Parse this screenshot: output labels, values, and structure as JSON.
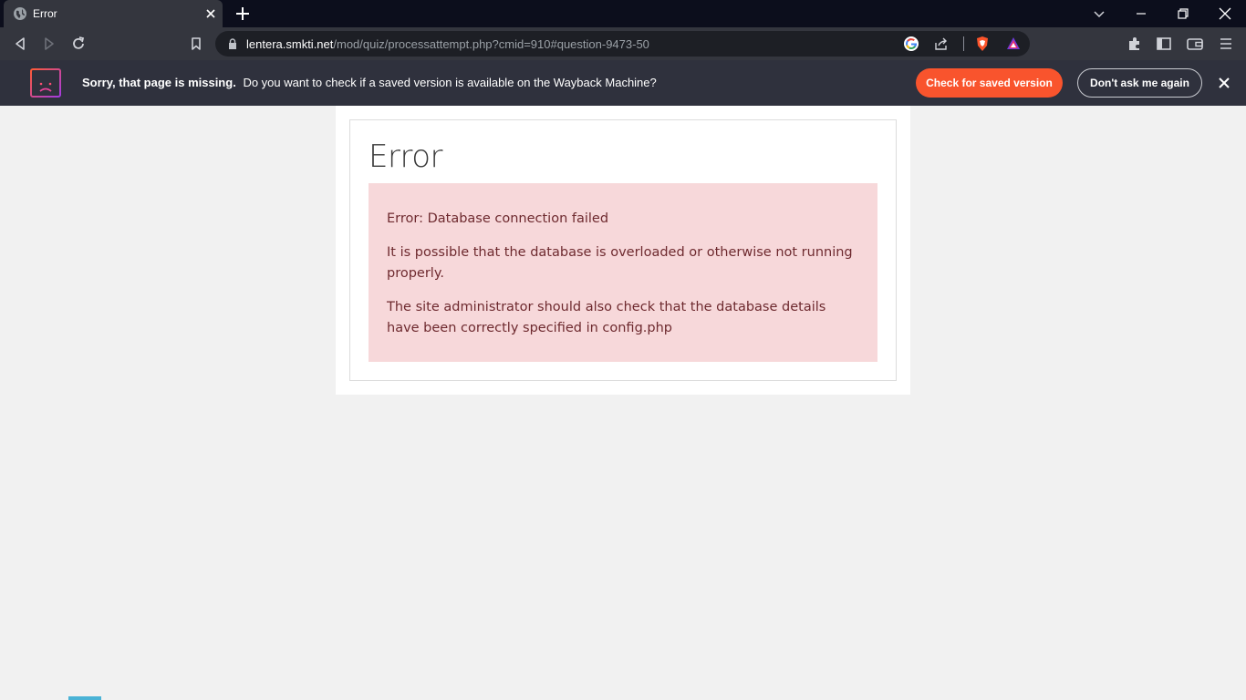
{
  "tab": {
    "title": "Error",
    "favicon": "globe-icon"
  },
  "toolbar": {
    "url_host": "lentera.smkti.net",
    "url_path": "/mod/quiz/processattempt.php?cmid=910#question-9473-50"
  },
  "infobar": {
    "title": "Sorry, that page is missing.",
    "message": "Do you want to check if a saved version is available on the Wayback Machine?",
    "check_button": "Check for saved version",
    "dont_ask_button": "Don't ask me again",
    "accent_color": "#f9542d"
  },
  "page": {
    "heading": "Error",
    "error_line": "Error: Database connection failed",
    "paragraph1": "It is possible that the database is overloaded or otherwise not running properly.",
    "paragraph2": "The site administrator should also check that the database details have been correctly specified in config.php",
    "alert_bg": "#f7d8da"
  }
}
